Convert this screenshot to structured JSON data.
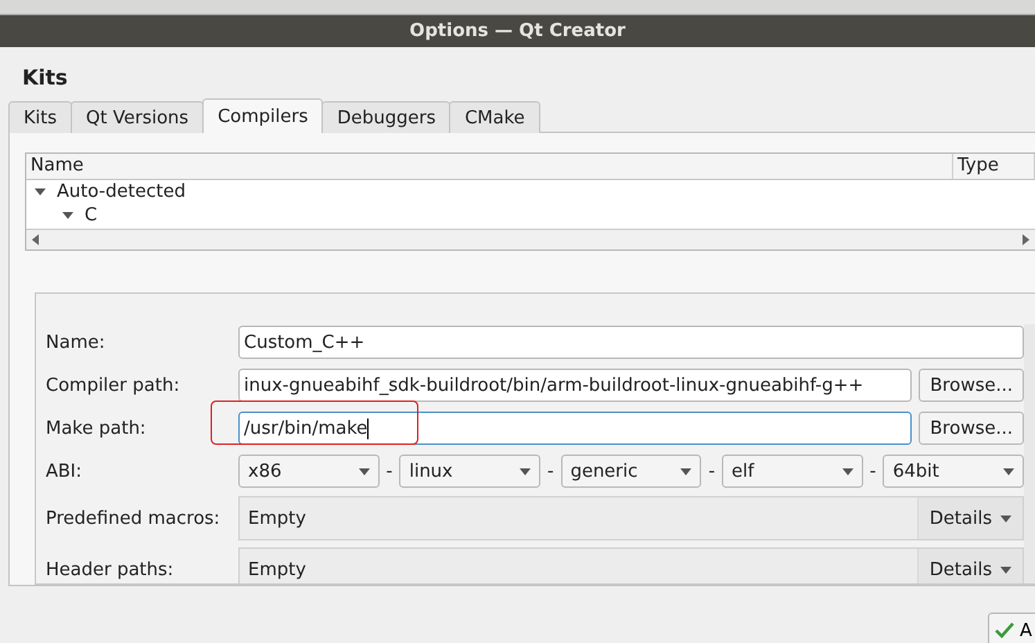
{
  "window": {
    "title": "Options — Qt Creator"
  },
  "page_title": "Kits",
  "tabs": [
    {
      "label": "Kits",
      "selected": false
    },
    {
      "label": "Qt Versions",
      "selected": false
    },
    {
      "label": "Compilers",
      "selected": true
    },
    {
      "label": "Debuggers",
      "selected": false
    },
    {
      "label": "CMake",
      "selected": false
    }
  ],
  "tree": {
    "columns": [
      "Name",
      "Type"
    ],
    "items": [
      {
        "label": "Auto-detected",
        "expanded": true,
        "children": [
          {
            "label": "C",
            "expanded": true
          }
        ]
      }
    ]
  },
  "form": {
    "name": {
      "label": "Name:",
      "value": "Custom_C++"
    },
    "compiler_path": {
      "label": "Compiler path:",
      "value": "inux-gnueabihf_sdk-buildroot/bin/arm-buildroot-linux-gnueabihf-g++",
      "button": "Browse..."
    },
    "make_path": {
      "label": "Make path:",
      "value": "/usr/bin/make",
      "button": "Browse...",
      "highlighted": true
    },
    "abi": {
      "label": "ABI:",
      "separator": "-",
      "options": [
        "x86",
        "linux",
        "generic",
        "elf",
        "64bit"
      ]
    },
    "predefined_macros": {
      "label": "Predefined macros:",
      "value": "Empty",
      "button": "Details"
    },
    "header_paths": {
      "label": "Header paths:",
      "value": "Empty",
      "button": "Details"
    }
  },
  "apply_button": {
    "label": "A"
  }
}
